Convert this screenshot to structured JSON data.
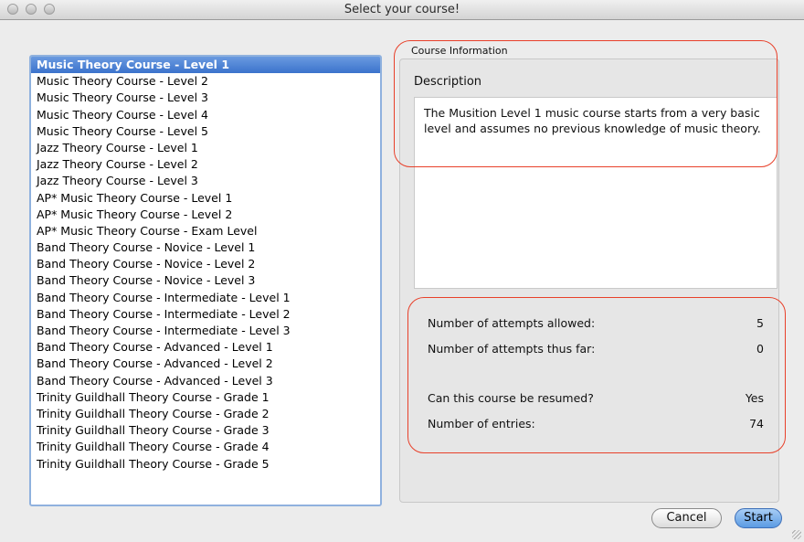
{
  "window": {
    "title": "Select your course!"
  },
  "courses": {
    "selected_index": 0,
    "items": [
      "Music Theory Course - Level 1",
      "Music Theory Course - Level 2",
      "Music Theory Course - Level 3",
      "Music Theory Course - Level 4",
      "Music Theory Course - Level 5",
      "Jazz Theory Course - Level 1",
      "Jazz Theory Course - Level 2",
      "Jazz Theory Course - Level 3",
      "AP* Music Theory Course - Level 1",
      "AP* Music Theory Course - Level 2",
      "AP* Music Theory Course - Exam Level",
      "Band Theory Course - Novice - Level 1",
      "Band Theory Course - Novice - Level 2",
      "Band Theory Course - Novice - Level 3",
      "Band Theory Course - Intermediate - Level 1",
      "Band Theory Course - Intermediate - Level 2",
      "Band Theory Course - Intermediate - Level 3",
      "Band Theory Course - Advanced - Level 1",
      "Band Theory Course - Advanced - Level 2",
      "Band Theory Course - Advanced - Level 3",
      "Trinity Guildhall Theory Course - Grade 1",
      "Trinity Guildhall Theory Course - Grade 2",
      "Trinity Guildhall Theory Course - Grade 3",
      "Trinity Guildhall Theory Course - Grade 4",
      "Trinity Guildhall Theory Course - Grade 5"
    ]
  },
  "course_info": {
    "group_title": "Course Information",
    "description_heading": "Description",
    "description_text": "The Musition Level 1 music course starts from a very basic level and assumes no previous knowledge of music theory.",
    "attempts_allowed_label": "Number of attempts allowed:",
    "attempts_allowed_value": "5",
    "attempts_so_far_label": "Number of attempts thus far:",
    "attempts_so_far_value": "0",
    "resumable_label": "Can this course be resumed?",
    "resumable_value": "Yes",
    "entries_label": "Number of entries:",
    "entries_value": "74"
  },
  "buttons": {
    "cancel_label": "Cancel",
    "start_label": "Start"
  },
  "colors": {
    "annotation": "#e8402a",
    "selection": "#3b73cc",
    "focus_ring": "#8fb1de"
  }
}
